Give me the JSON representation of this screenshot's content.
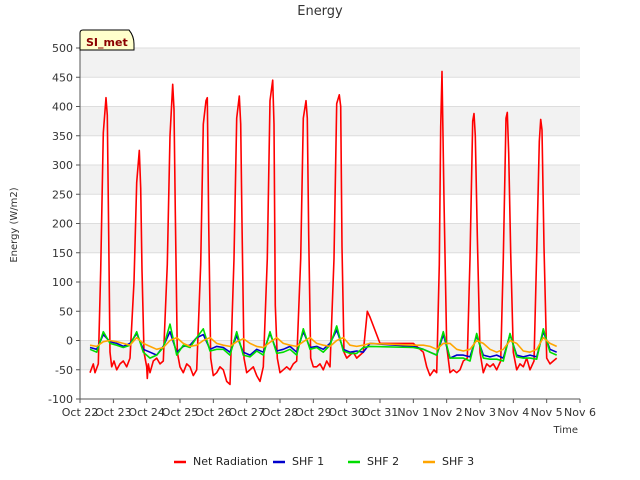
{
  "chart_data": {
    "type": "line",
    "title": "Energy",
    "xlabel": "Time",
    "ylabel": "Energy (W/m2)",
    "tag": "SI_met",
    "ylim": [
      -100,
      500
    ],
    "yticks": [
      -100,
      -50,
      0,
      50,
      100,
      150,
      200,
      250,
      300,
      350,
      400,
      450,
      500
    ],
    "xlim": [
      0,
      15
    ],
    "xticks": [
      {
        "v": 0,
        "label": "Oct 22"
      },
      {
        "v": 1,
        "label": "Oct 23"
      },
      {
        "v": 2,
        "label": "Oct 24"
      },
      {
        "v": 3,
        "label": "Oct 25"
      },
      {
        "v": 4,
        "label": "Oct 26"
      },
      {
        "v": 5,
        "label": "Oct 27"
      },
      {
        "v": 6,
        "label": "Oct 28"
      },
      {
        "v": 7,
        "label": "Oct 29"
      },
      {
        "v": 8,
        "label": "Oct 30"
      },
      {
        "v": 9,
        "label": "Oct 31"
      },
      {
        "v": 10,
        "label": "Nov 1"
      },
      {
        "v": 11,
        "label": "Nov 2"
      },
      {
        "v": 12,
        "label": "Nov 3"
      },
      {
        "v": 13,
        "label": "Nov 4"
      },
      {
        "v": 14,
        "label": "Nov 5"
      },
      {
        "v": 15,
        "label": "Nov 6"
      }
    ],
    "grid": true,
    "legend_position": "bottom",
    "series": [
      {
        "name": "Net Radiation",
        "color": "#ff0000",
        "x": [
          0.3,
          0.4,
          0.45,
          0.55,
          0.62,
          0.7,
          0.78,
          0.82,
          0.86,
          0.9,
          0.95,
          1.02,
          1.1,
          1.2,
          1.3,
          1.4,
          1.5,
          1.62,
          1.7,
          1.78,
          1.82,
          1.86,
          1.92,
          2.0,
          2.02,
          2.05,
          2.1,
          2.2,
          2.3,
          2.4,
          2.5,
          2.62,
          2.7,
          2.78,
          2.82,
          2.86,
          2.92,
          3.0,
          3.1,
          3.2,
          3.3,
          3.4,
          3.5,
          3.62,
          3.7,
          3.78,
          3.82,
          3.86,
          3.92,
          4.0,
          4.1,
          4.2,
          4.3,
          4.4,
          4.5,
          4.62,
          4.7,
          4.78,
          4.82,
          4.86,
          4.92,
          5.0,
          5.1,
          5.2,
          5.3,
          5.4,
          5.5,
          5.62,
          5.7,
          5.78,
          5.82,
          5.86,
          5.92,
          6.0,
          6.1,
          6.2,
          6.3,
          6.4,
          6.5,
          6.62,
          6.7,
          6.78,
          6.82,
          6.86,
          6.92,
          7.0,
          7.1,
          7.2,
          7.3,
          7.4,
          7.5,
          7.62,
          7.7,
          7.78,
          7.82,
          7.86,
          7.92,
          8.0,
          8.1,
          8.2,
          8.3,
          8.4,
          8.5,
          8.62,
          8.7,
          9.0,
          10.0,
          10.3,
          10.4,
          10.5,
          10.62,
          10.7,
          10.78,
          10.82,
          10.86,
          10.92,
          11.0,
          11.1,
          11.2,
          11.3,
          11.4,
          11.5,
          11.62,
          11.7,
          11.78,
          11.82,
          11.86,
          11.92,
          12.0,
          12.1,
          12.2,
          12.3,
          12.4,
          12.5,
          12.62,
          12.7,
          12.78,
          12.82,
          12.86,
          12.92,
          13.0,
          13.1,
          13.2,
          13.3,
          13.4,
          13.5,
          13.62,
          13.7,
          13.78,
          13.82,
          13.86,
          13.92,
          14.0,
          14.1,
          14.2,
          14.3
        ],
        "y": [
          -55,
          -40,
          -55,
          -40,
          120,
          355,
          415,
          385,
          180,
          -20,
          -45,
          -35,
          -50,
          -40,
          -35,
          -45,
          -30,
          100,
          270,
          325,
          260,
          120,
          -20,
          -45,
          -65,
          -40,
          -55,
          -35,
          -30,
          -40,
          -35,
          130,
          350,
          438,
          395,
          220,
          -20,
          -45,
          -55,
          -40,
          -45,
          -60,
          -50,
          130,
          370,
          410,
          415,
          200,
          -30,
          -60,
          -55,
          -45,
          -50,
          -70,
          -75,
          140,
          380,
          418,
          370,
          200,
          -30,
          -55,
          -50,
          -45,
          -60,
          -70,
          -45,
          140,
          410,
          445,
          370,
          60,
          -30,
          -55,
          -50,
          -45,
          -50,
          -40,
          -35,
          140,
          380,
          410,
          380,
          180,
          -30,
          -45,
          -45,
          -40,
          -50,
          -35,
          -45,
          140,
          405,
          420,
          400,
          160,
          -20,
          -30,
          -25,
          -20,
          -30,
          -25,
          -20,
          50,
          40,
          -5,
          -5,
          -20,
          -45,
          -60,
          -50,
          -55,
          130,
          365,
          460,
          240,
          -10,
          -55,
          -50,
          -55,
          -50,
          -35,
          -30,
          140,
          375,
          388,
          350,
          180,
          -20,
          -55,
          -40,
          -45,
          -40,
          -50,
          -35,
          140,
          380,
          390,
          320,
          150,
          -20,
          -50,
          -40,
          -45,
          -30,
          -50,
          -35,
          150,
          340,
          378,
          360,
          160,
          -30,
          -40,
          -35,
          -30
        ]
      },
      {
        "name": "SHF 1",
        "color": "#0000cc",
        "x": [
          0.3,
          0.5,
          0.7,
          0.9,
          1.1,
          1.3,
          1.5,
          1.7,
          1.9,
          2.1,
          2.3,
          2.5,
          2.7,
          2.9,
          3.1,
          3.3,
          3.5,
          3.7,
          3.9,
          4.1,
          4.3,
          4.5,
          4.7,
          4.9,
          5.1,
          5.3,
          5.5,
          5.7,
          5.9,
          6.1,
          6.3,
          6.5,
          6.7,
          6.9,
          7.1,
          7.3,
          7.5,
          7.7,
          7.9,
          8.1,
          8.3,
          8.5,
          8.7,
          10.0,
          10.3,
          10.5,
          10.7,
          10.9,
          11.1,
          11.3,
          11.5,
          11.7,
          11.9,
          12.1,
          12.3,
          12.5,
          12.7,
          12.9,
          13.1,
          13.3,
          13.5,
          13.7,
          13.9,
          14.1,
          14.3
        ],
        "y": [
          -12,
          -15,
          10,
          -2,
          -5,
          -10,
          -5,
          12,
          -15,
          -20,
          -25,
          -10,
          15,
          -20,
          -10,
          -8,
          5,
          10,
          -15,
          -10,
          -12,
          -20,
          8,
          -20,
          -25,
          -15,
          -20,
          12,
          -18,
          -15,
          -10,
          -20,
          15,
          -12,
          -10,
          -15,
          -5,
          18,
          -15,
          -20,
          -18,
          -20,
          -5,
          -10,
          -15,
          -20,
          -25,
          10,
          -30,
          -25,
          -25,
          -28,
          8,
          -25,
          -28,
          -25,
          -30,
          10,
          -25,
          -28,
          -25,
          -28,
          15,
          -15,
          -20
        ]
      },
      {
        "name": "SHF 2",
        "color": "#00dd00",
        "x": [
          0.3,
          0.5,
          0.7,
          0.9,
          1.1,
          1.3,
          1.5,
          1.7,
          1.9,
          2.1,
          2.3,
          2.5,
          2.7,
          2.9,
          3.1,
          3.3,
          3.5,
          3.7,
          3.9,
          4.1,
          4.3,
          4.5,
          4.7,
          4.9,
          5.1,
          5.3,
          5.5,
          5.7,
          5.9,
          6.1,
          6.3,
          6.5,
          6.7,
          6.9,
          7.1,
          7.3,
          7.5,
          7.7,
          7.9,
          8.1,
          8.3,
          8.5,
          8.7,
          10.0,
          10.3,
          10.5,
          10.7,
          10.9,
          11.1,
          11.3,
          11.5,
          11.7,
          11.9,
          12.1,
          12.3,
          12.5,
          12.7,
          12.9,
          13.1,
          13.3,
          13.5,
          13.7,
          13.9,
          14.1,
          14.3
        ],
        "y": [
          -15,
          -20,
          15,
          -5,
          -8,
          -12,
          -8,
          15,
          -20,
          -30,
          -25,
          -12,
          28,
          -25,
          -8,
          -12,
          5,
          20,
          -18,
          -15,
          -15,
          -25,
          15,
          -25,
          -28,
          -18,
          -25,
          15,
          -22,
          -20,
          -15,
          -25,
          20,
          -15,
          -12,
          -20,
          -8,
          25,
          -18,
          -22,
          -22,
          -12,
          -10,
          -12,
          -15,
          -20,
          -25,
          15,
          -30,
          -30,
          -30,
          -35,
          12,
          -30,
          -32,
          -32,
          -35,
          12,
          -28,
          -30,
          -30,
          -32,
          20,
          -20,
          -25
        ]
      },
      {
        "name": "SHF 3",
        "color": "#ffa500",
        "x": [
          0.3,
          0.5,
          0.7,
          0.9,
          1.1,
          1.3,
          1.5,
          1.7,
          1.9,
          2.1,
          2.3,
          2.5,
          2.7,
          2.9,
          3.1,
          3.3,
          3.5,
          3.7,
          3.9,
          4.1,
          4.3,
          4.5,
          4.7,
          4.9,
          5.1,
          5.3,
          5.5,
          5.7,
          5.9,
          6.1,
          6.3,
          6.5,
          6.7,
          6.9,
          7.1,
          7.3,
          7.5,
          7.7,
          7.9,
          8.1,
          8.3,
          8.5,
          8.7,
          10.0,
          10.3,
          10.5,
          10.7,
          10.9,
          11.1,
          11.3,
          11.5,
          11.7,
          11.9,
          12.1,
          12.3,
          12.5,
          12.7,
          12.9,
          13.1,
          13.3,
          13.5,
          13.7,
          13.9,
          14.1,
          14.3
        ],
        "y": [
          -8,
          -10,
          -2,
          0,
          -2,
          -5,
          -8,
          5,
          -5,
          -10,
          -15,
          -12,
          0,
          5,
          -5,
          -10,
          -8,
          0,
          5,
          -5,
          -8,
          -10,
          -2,
          3,
          -5,
          -10,
          -12,
          -3,
          5,
          -5,
          -8,
          -10,
          -2,
          5,
          -5,
          -8,
          -10,
          0,
          5,
          -8,
          -10,
          -8,
          -5,
          -8,
          -8,
          -10,
          -15,
          -5,
          -5,
          -15,
          -18,
          -15,
          0,
          -5,
          -15,
          -20,
          -15,
          0,
          -5,
          -18,
          -20,
          -15,
          5,
          -5,
          -10
        ]
      }
    ]
  }
}
